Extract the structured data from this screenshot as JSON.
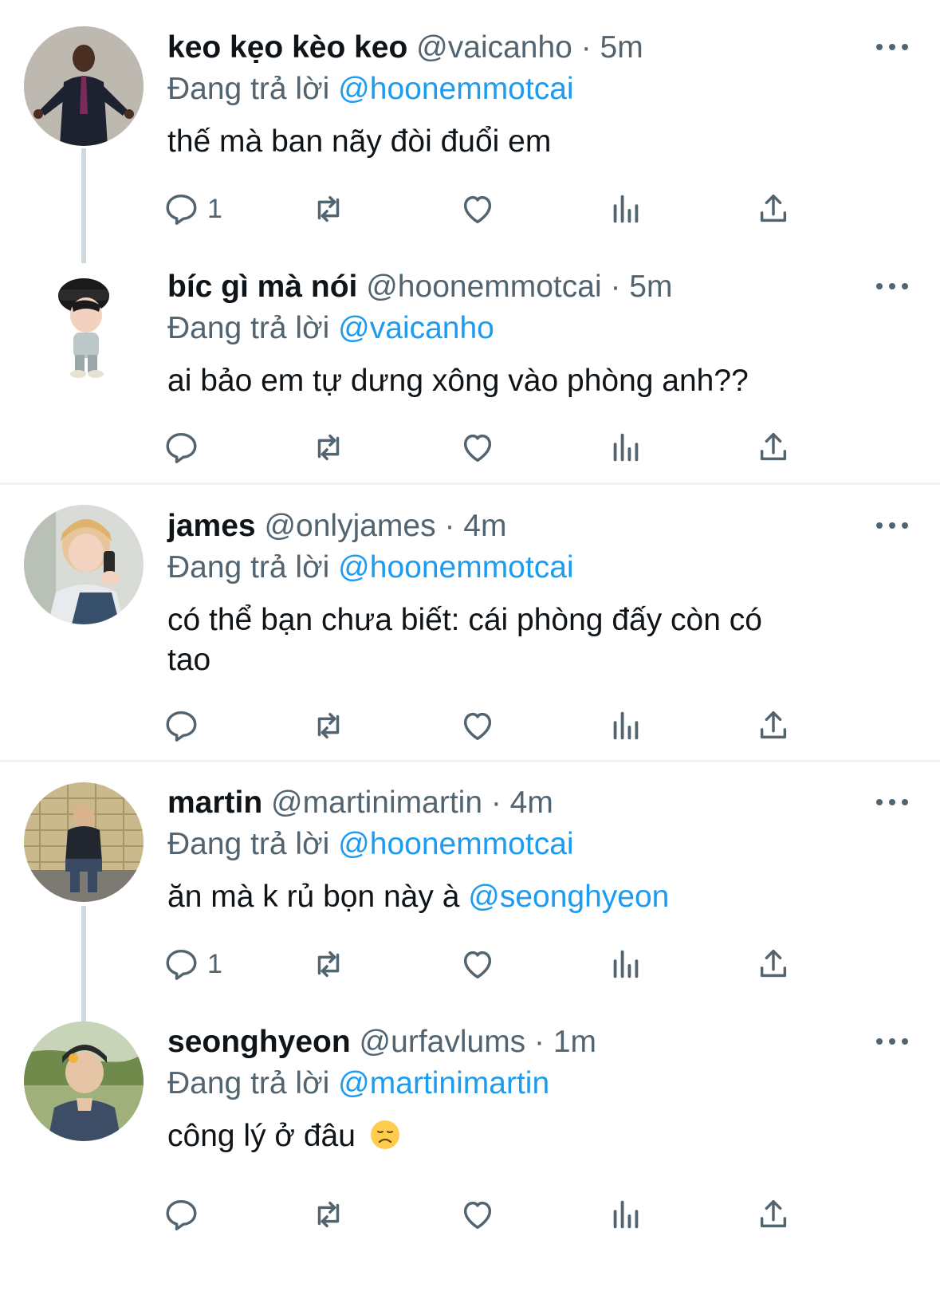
{
  "reply_prefix": "Đang trả lời",
  "colors": {
    "mention": "#1d9bf0",
    "secondary": "#536471",
    "thread_line": "#cfd9de"
  },
  "tweets": [
    {
      "display_name": "keo kẹo kèo keo",
      "handle": "@vaicanho",
      "time": "· 5m",
      "reply_to": "@hoonemmotcai",
      "text": "thế mà ban nãy đòi đuổi em",
      "reply_count": "1"
    },
    {
      "display_name": "bíc gì mà nói",
      "handle": "@hoonemmotcai",
      "time": "· 5m",
      "reply_to": "@vaicanho",
      "text": "ai bảo em tự dưng xông vào phòng anh??",
      "reply_count": ""
    },
    {
      "display_name": "james",
      "handle": "@onlyjames",
      "time": "· 4m",
      "reply_to": "@hoonemmotcai",
      "text_line1": "có thể bạn chưa biết: cái phòng đấy còn có",
      "text_line2": "tao",
      "reply_count": ""
    },
    {
      "display_name": "martin",
      "handle": "@martinimartin",
      "time": "· 4m",
      "reply_to": "@hoonemmotcai",
      "text": "ăn mà k rủ bọn này à",
      "text_mention": "@seonghyeon",
      "reply_count": "1"
    },
    {
      "display_name": "seonghyeon",
      "handle": "@urfavlums",
      "time": "· 1m",
      "reply_to": "@martinimartin",
      "text": "công lý ở đâu",
      "emoji": "disappointed-face-emoji",
      "reply_count": ""
    }
  ],
  "icons": [
    "reply-icon",
    "retweet-icon",
    "like-icon",
    "views-icon",
    "share-icon",
    "more-icon"
  ]
}
